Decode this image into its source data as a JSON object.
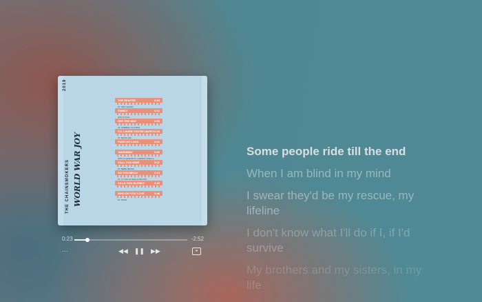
{
  "album": {
    "year": "2019",
    "band": "THE CHAINSMOKERS",
    "title": "WORLD WAR JOY",
    "tracks": [
      {
        "name": "THE REAPER",
        "time": "3:04",
        "ft": "FT. AMY SHARK"
      },
      {
        "name": "FAMILY",
        "time": "3:21",
        "ft": "WITH KYGO"
      },
      {
        "name": "SEE THE WAY",
        "time": "2:56",
        "ft": "FT. SABRINA CLAUDIO"
      },
      {
        "name": "P.S. I HOPE YOU'RE HAPPY",
        "time": "2:43",
        "ft": "FT. BLINK-182"
      },
      {
        "name": "PUSH MY LUCK",
        "time": "3:01",
        "ft": ""
      },
      {
        "name": "TAKEAWAY",
        "time": "3:30",
        "ft": "WITH ILLENIUM FT. LENNON STELLA"
      },
      {
        "name": "CALL YOU MINE",
        "time": "3:37",
        "ft": "FT. BEBE REXHA"
      },
      {
        "name": "DO YOU MEAN",
        "time": "3:13",
        "ft": "FT. TY DOLLA SIGN & BULOW"
      },
      {
        "name": "KILLS YOU SLOWLY",
        "time": "3:33",
        "ft": ""
      },
      {
        "name": "WHO DO YOU LOVE",
        "time": "3:46",
        "ft": "FT. 5SOS"
      }
    ]
  },
  "player": {
    "elapsed": "0:23",
    "remaining": "-2:52",
    "progress": 0.115,
    "more_label": "···",
    "rewind_icon": "◀◀",
    "pause_icon": "❚❚",
    "forward_icon": "▶▶",
    "lyrics_icon": "❝"
  },
  "lyrics": [
    "Some people ride till the end",
    "When I am blind in my mind",
    "I swear they'd be my rescue, my lifeline",
    "I don't know what I'll do if I, if I'd survive",
    "My brothers and my sisters, in my life"
  ]
}
